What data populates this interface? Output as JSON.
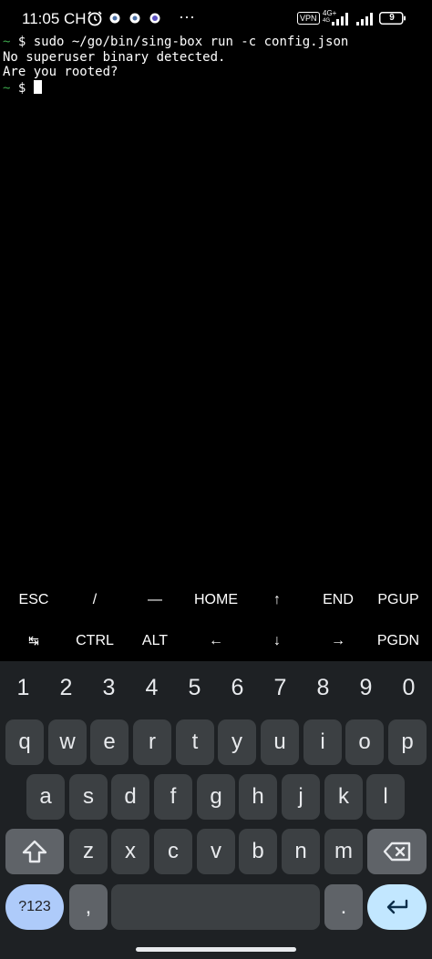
{
  "status_bar": {
    "time": "11:05 CH",
    "more": "···",
    "vpn": "VPN",
    "network_top": "4G+",
    "network_bottom": "4G",
    "battery": "9"
  },
  "terminal": {
    "lines": [
      {
        "prompt": "~",
        "text": " $ sudo ~/go/bin/sing-box run -c config.json"
      },
      {
        "prompt": "",
        "text": "No superuser binary detected."
      },
      {
        "prompt": "",
        "text": "Are you rooted?"
      },
      {
        "prompt": "~",
        "text": " $ "
      }
    ]
  },
  "extra_keys": {
    "row1": [
      "ESC",
      "/",
      "—",
      "HOME",
      "↑",
      "END",
      "PGUP"
    ],
    "row2": [
      "↹",
      "CTRL",
      "ALT",
      "←",
      "↓",
      "→",
      "PGDN"
    ]
  },
  "keyboard": {
    "numbers": [
      "1",
      "2",
      "3",
      "4",
      "5",
      "6",
      "7",
      "8",
      "9",
      "0"
    ],
    "row1": [
      "q",
      "w",
      "e",
      "r",
      "t",
      "y",
      "u",
      "i",
      "o",
      "p"
    ],
    "row2": [
      "a",
      "s",
      "d",
      "f",
      "g",
      "h",
      "j",
      "k",
      "l"
    ],
    "row3": [
      "z",
      "x",
      "c",
      "v",
      "b",
      "n",
      "m"
    ],
    "symbols": "?123",
    "comma": ",",
    "period": "."
  }
}
